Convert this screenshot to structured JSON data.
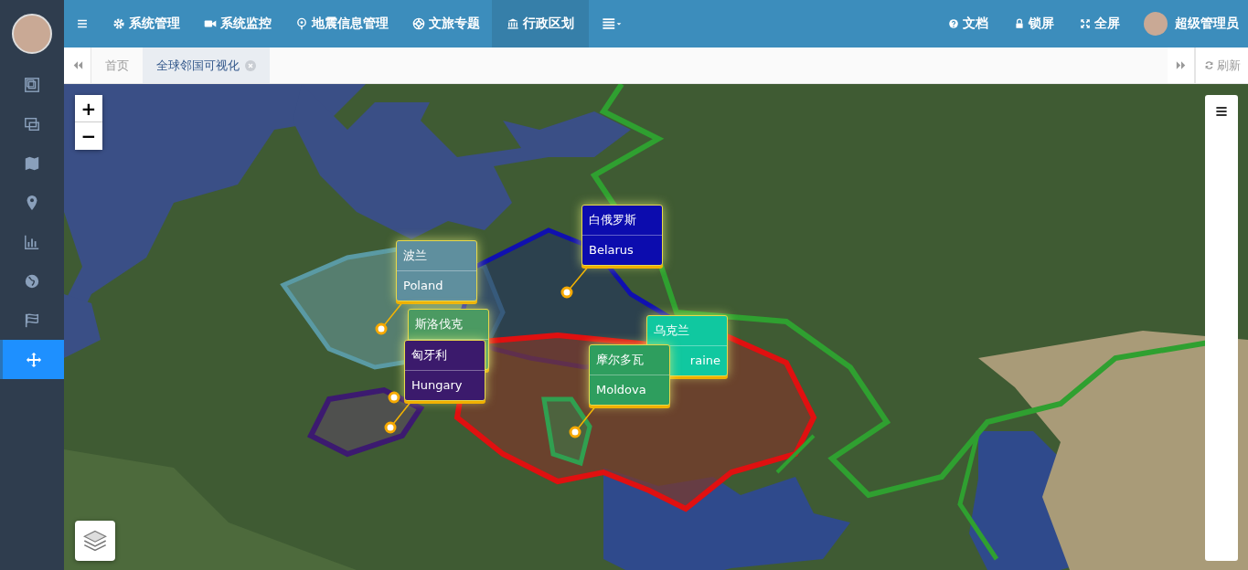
{
  "sidebar": {
    "items": [
      {
        "selected": false
      },
      {
        "selected": false
      },
      {
        "selected": false
      },
      {
        "selected": false
      },
      {
        "selected": false
      },
      {
        "selected": false
      },
      {
        "selected": false
      },
      {
        "selected": true
      }
    ]
  },
  "topbar": {
    "menu": [
      {
        "label": "系统管理",
        "selected": false
      },
      {
        "label": "系统监控",
        "selected": false
      },
      {
        "label": "地震信息管理",
        "selected": false
      },
      {
        "label": "文旅专题",
        "selected": false
      },
      {
        "label": "行政区划",
        "selected": true
      }
    ],
    "right": [
      {
        "label": "文档"
      },
      {
        "label": "锁屏"
      },
      {
        "label": "全屏"
      }
    ],
    "user": "超级管理员"
  },
  "tabs": {
    "items": [
      {
        "label": "首页",
        "selected": false,
        "closable": false
      },
      {
        "label": "全球邻国可视化",
        "selected": true,
        "closable": true
      }
    ],
    "refresh": "刷新"
  },
  "map": {
    "zoom_in": "+",
    "zoom_out": "−",
    "popups": [
      {
        "name": "波兰",
        "en": "Poland",
        "color": "#5f8f9e"
      },
      {
        "name": "白俄罗斯",
        "en": "Belarus",
        "color": "#0c0cae"
      },
      {
        "name": "乌克兰",
        "en": "raine",
        "color": "#10c8a0"
      },
      {
        "name": "斯洛伐克",
        "color": "#4b9a62"
      },
      {
        "name": "匈牙利",
        "en": "Hungary",
        "color": "#3b1a6c"
      },
      {
        "name": "摩尔多瓦",
        "en": "Moldova",
        "color": "#2e9e5e"
      }
    ]
  }
}
